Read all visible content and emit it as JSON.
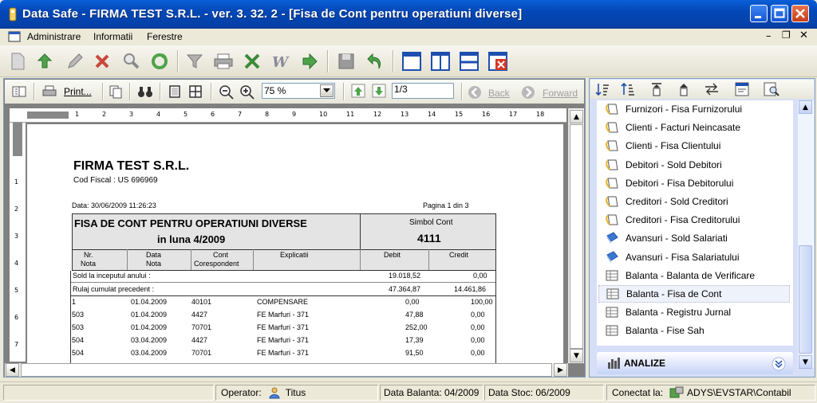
{
  "window": {
    "title": "Data Safe - FIRMA TEST S.R.L. - ver. 3. 32. 2 - [Fisa de Cont pentru operatiuni diverse]"
  },
  "menu": {
    "items": [
      "Administrare",
      "Informatii",
      "Ferestre"
    ]
  },
  "preview_toolbar": {
    "print_label": "Print...",
    "zoom_value": "75 %",
    "page_value": "1/3",
    "back_label": "Back",
    "forward_label": "Forward"
  },
  "ruler": {
    "h_marks": [
      "1",
      "2",
      "3",
      "4",
      "5",
      "6",
      "7",
      "8",
      "9",
      "10",
      "11",
      "12",
      "13",
      "14",
      "15",
      "16",
      "17",
      "18"
    ],
    "v_marks": [
      "1",
      "2",
      "3",
      "4",
      "5",
      "6",
      "7"
    ]
  },
  "report": {
    "company": "FIRMA TEST S.R.L.",
    "fiscal_code": "Cod Fiscal : US 696969",
    "date_label": "Data: 30/06/2009 11:26:23",
    "page_label": "Pagina  1  din  3",
    "title_line1": "FISA DE CONT PENTRU OPERATIUNI DIVERSE",
    "title_line2": "in luna 4/2009",
    "symbol_label": "Simbol Cont",
    "symbol_value": "4111",
    "col_nr": "Nr.\nNota",
    "col_nr_1": "Nr.",
    "col_nr_2": "Nota",
    "col_data_1": "Data",
    "col_data_2": "Nota",
    "col_cont_1": "Cont",
    "col_cont_2": "Corespondent",
    "col_explicatii": "Explicatii",
    "col_debit": "Debit",
    "col_credit": "Credit",
    "sold_label": "Sold la inceputul anului :",
    "sold_debit": "19.018,52",
    "sold_credit": "0,00",
    "rulaj_label": "Rulaj cumulat precedent :",
    "rulaj_debit": "47.364,87",
    "rulaj_credit": "14.461,86",
    "rows": [
      {
        "nr": "1",
        "data": "01.04.2009",
        "cont": "40101",
        "expl": "COMPENSARE",
        "debit": "0,00",
        "credit": "100,00"
      },
      {
        "nr": "503",
        "data": "01.04.2009",
        "cont": "4427",
        "expl": "FE Marfuri - 371",
        "debit": "47,88",
        "credit": "0,00"
      },
      {
        "nr": "503",
        "data": "01.04.2009",
        "cont": "70701",
        "expl": "FE Marfuri - 371",
        "debit": "252,00",
        "credit": "0,00"
      },
      {
        "nr": "504",
        "data": "03.04.2009",
        "cont": "4427",
        "expl": "FE Marfuri - 371",
        "debit": "17,39",
        "credit": "0,00"
      },
      {
        "nr": "504",
        "data": "03.04.2009",
        "cont": "70701",
        "expl": "FE Marfuri - 371",
        "debit": "91,50",
        "credit": "0,00"
      }
    ]
  },
  "right_panel": {
    "items": [
      {
        "label": "Furnizori - Fisa Furnizorului",
        "icon": "ledger-icon"
      },
      {
        "label": "Clienti - Facturi Neincasate",
        "icon": "ledger-icon"
      },
      {
        "label": "Clienti - Fisa Clientului",
        "icon": "ledger-icon"
      },
      {
        "label": "Debitori - Sold Debitori",
        "icon": "ledger-icon"
      },
      {
        "label": "Debitori - Fisa Debitorului",
        "icon": "ledger-icon"
      },
      {
        "label": "Creditori - Sold Creditori",
        "icon": "ledger-icon"
      },
      {
        "label": "Creditori - Fisa Creditorului",
        "icon": "ledger-icon"
      },
      {
        "label": "Avansuri - Sold Salariati",
        "icon": "book-icon"
      },
      {
        "label": "Avansuri - Fisa Salariatului",
        "icon": "book-icon"
      },
      {
        "label": "Balanta - Balanta de Verificare",
        "icon": "sheet-icon"
      },
      {
        "label": "Balanta - Fisa de Cont",
        "icon": "sheet-icon"
      },
      {
        "label": "Balanta - Registru Jurnal",
        "icon": "sheet-icon"
      },
      {
        "label": "Balanta - Fise Sah",
        "icon": "sheet-icon"
      }
    ],
    "analize_label": "ANALIZE"
  },
  "status": {
    "operator_label": "Operator:",
    "operator_value": "Titus",
    "data_balanta": "Data Balanta: 04/2009",
    "data_stoc": "Data Stoc: 06/2009",
    "conectat_label": "Conectat la:",
    "conectat_value": "ADYS\\EVSTAR\\Contabil"
  },
  "colors": {
    "title_bar": "#0447b6",
    "selection": "#eef2fb",
    "panel_bg": "#d6dff7"
  }
}
